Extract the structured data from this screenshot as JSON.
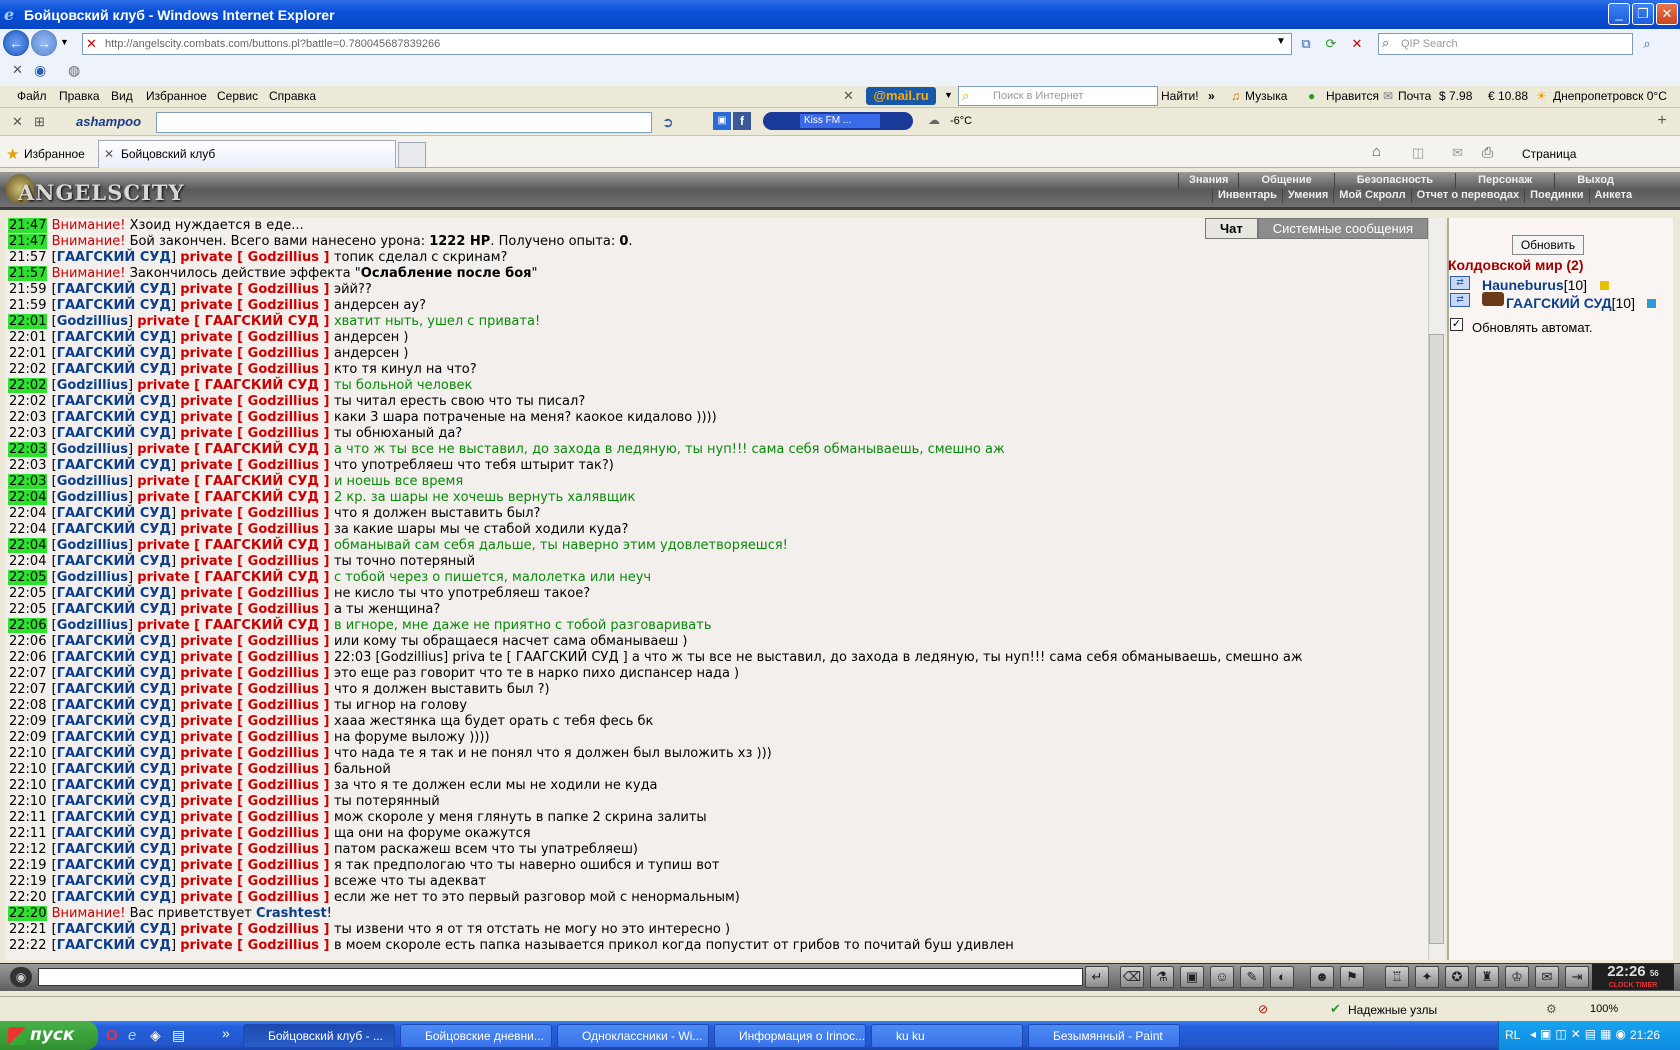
{
  "window": {
    "title": "Бойцовский клуб - Windows Internet Explorer"
  },
  "address": {
    "url": "http://angelscity.combats.com/buttons.pl?battle=0.780045687839266",
    "search_placeholder": "QIP Search"
  },
  "menu": [
    "Файл",
    "Правка",
    "Вид",
    "Избранное",
    "Сервис",
    "Справка"
  ],
  "toolbar_mailru": {
    "logo": "@mail.ru",
    "search_placeholder": "Поиск в Интернет",
    "find": "Найти!",
    "music": "Музыка",
    "like": "Нравится",
    "mail": "Почта",
    "usd": "$ 7.98",
    "eur": "€ 10.88",
    "weather": "Днепропетровск 0°C"
  },
  "toolbar2": {
    "brand": "ashampoo",
    "radio": "Kiss FM ...",
    "temp": "-6°C"
  },
  "favorites": {
    "label": "Избранное",
    "tab": "Бойцовский клуб",
    "page_menu": "Страница"
  },
  "game": {
    "logo": "ANGELSCITY",
    "nav_top": [
      "Знания",
      "Общение",
      "Безопасность",
      "Персонаж",
      "Выход"
    ],
    "nav_bottom": [
      "Инвентарь",
      "Умения",
      "Мой Скролл",
      "Отчет о переводах",
      "Поединки",
      "Анкета"
    ]
  },
  "chat_tabs": [
    "Чат",
    "Системные сообщения"
  ],
  "chat": [
    {
      "t": "21:47",
      "hl": true,
      "kind": "warn",
      "text": "Хзоид нуждается в еде..."
    },
    {
      "t": "21:47",
      "hl": true,
      "kind": "warn2",
      "text": "Бой закончен. Всего вами нанесено урона: ",
      "bold1": "1222 HP",
      "mid": ". Получено опыта: ",
      "bold2": "0",
      "tail": "."
    },
    {
      "t": "21:57",
      "kind": "priv",
      "from": "ГААГСКИЙ СУД",
      "to": "Godzillius",
      "text": "топик сделал с скринам?"
    },
    {
      "t": "21:57",
      "hl": true,
      "kind": "warn3",
      "text": "Закончилось действие эффекта \"",
      "bold1": "Ослабление после боя",
      "tail": "\""
    },
    {
      "t": "21:59",
      "kind": "priv",
      "from": "ГААГСКИЙ СУД",
      "to": "Godzillius",
      "text": "эйй??"
    },
    {
      "t": "21:59",
      "kind": "priv",
      "from": "ГААГСКИЙ СУД",
      "to": "Godzillius",
      "text": "андерсен ау?"
    },
    {
      "t": "22:01",
      "hl": true,
      "kind": "privg",
      "from": "Godzillius",
      "to": "ГААГСКИЙ СУД",
      "text": "хватит ныть, ушел с привата!"
    },
    {
      "t": "22:01",
      "kind": "priv",
      "from": "ГААГСКИЙ СУД",
      "to": "Godzillius",
      "text": "андерсен )"
    },
    {
      "t": "22:01",
      "kind": "priv",
      "from": "ГААГСКИЙ СУД",
      "to": "Godzillius",
      "text": "андерсен )"
    },
    {
      "t": "22:02",
      "kind": "priv",
      "from": "ГААГСКИЙ СУД",
      "to": "Godzillius",
      "text": "кто тя кинул на что?"
    },
    {
      "t": "22:02",
      "hl": true,
      "kind": "privg",
      "from": "Godzillius",
      "to": "ГААГСКИЙ СУД",
      "text": "ты больной человек"
    },
    {
      "t": "22:02",
      "kind": "priv",
      "from": "ГААГСКИЙ СУД",
      "to": "Godzillius",
      "text": "ты читал ересть свою что ты писал?"
    },
    {
      "t": "22:03",
      "kind": "priv",
      "from": "ГААГСКИЙ СУД",
      "to": "Godzillius",
      "text": "каки 3 шара потраченые на меня? каокое кидалово ))))"
    },
    {
      "t": "22:03",
      "kind": "priv",
      "from": "ГААГСКИЙ СУД",
      "to": "Godzillius",
      "text": "ты обнюханый да?"
    },
    {
      "t": "22:03",
      "hl": true,
      "kind": "privg",
      "from": "Godzillius",
      "to": "ГААГСКИЙ СУД",
      "text": "а что ж ты все не выставил, до захода в ледяную, ты нуп!!! сама себя обманываешь, смешно аж"
    },
    {
      "t": "22:03",
      "kind": "priv",
      "from": "ГААГСКИЙ СУД",
      "to": "Godzillius",
      "text": "что употребляеш что тебя штырит так?)"
    },
    {
      "t": "22:03",
      "hl": true,
      "kind": "privg",
      "from": "Godzillius",
      "to": "ГААГСКИЙ СУД",
      "text": "и ноешь все время"
    },
    {
      "t": "22:04",
      "hl": true,
      "kind": "privg",
      "from": "Godzillius",
      "to": "ГААГСКИЙ СУД",
      "text": "2 кр. за шары не хочешь вернуть халявщик"
    },
    {
      "t": "22:04",
      "kind": "priv",
      "from": "ГААГСКИЙ СУД",
      "to": "Godzillius",
      "text": "что я должен выставить был?"
    },
    {
      "t": "22:04",
      "kind": "priv",
      "from": "ГААГСКИЙ СУД",
      "to": "Godzillius",
      "text": "за какие шары мы че стабой ходили куда?"
    },
    {
      "t": "22:04",
      "hl": true,
      "kind": "privg",
      "from": "Godzillius",
      "to": "ГААГСКИЙ СУД",
      "text": "обманывай сам себя дальше, ты наверно этим удовлетворяешся!"
    },
    {
      "t": "22:04",
      "kind": "priv",
      "from": "ГААГСКИЙ СУД",
      "to": "Godzillius",
      "text": "ты точно потеряный"
    },
    {
      "t": "22:05",
      "hl": true,
      "kind": "privg",
      "from": "Godzillius",
      "to": "ГААГСКИЙ СУД",
      "text": "с тобой через о пишется, малолетка или неуч"
    },
    {
      "t": "22:05",
      "kind": "priv",
      "from": "ГААГСКИЙ СУД",
      "to": "Godzillius",
      "text": "не кисло ты что употребляеш такое?"
    },
    {
      "t": "22:05",
      "kind": "priv",
      "from": "ГААГСКИЙ СУД",
      "to": "Godzillius",
      "text": "а ты женщина?"
    },
    {
      "t": "22:06",
      "hl": true,
      "kind": "privg",
      "from": "Godzillius",
      "to": "ГААГСКИЙ СУД",
      "text": "в игноре, мне даже не приятно с тобой разговаривать"
    },
    {
      "t": "22:06",
      "kind": "priv",
      "from": "ГААГСКИЙ СУД",
      "to": "Godzillius",
      "text": "или кому ты обращаеся насчет сама обманываеш )"
    },
    {
      "t": "22:06",
      "kind": "priv",
      "from": "ГААГСКИЙ СУД",
      "to": "Godzillius",
      "text": "22:03 [Godzillius] priva te [ ГААГСКИЙ СУД ] а что ж ты все не выставил, до захода в ледяную, ты нуп!!! сама себя обманываешь, смешно аж"
    },
    {
      "t": "22:07",
      "kind": "priv",
      "from": "ГААГСКИЙ СУД",
      "to": "Godzillius",
      "text": "это еще раз говорит что те в нарко пихо диспансер нада )"
    },
    {
      "t": "22:07",
      "kind": "priv",
      "from": "ГААГСКИЙ СУД",
      "to": "Godzillius",
      "text": "что я должен выставить был ?)"
    },
    {
      "t": "22:08",
      "kind": "priv",
      "from": "ГААГСКИЙ СУД",
      "to": "Godzillius",
      "text": "ты игнор на голову"
    },
    {
      "t": "22:09",
      "kind": "priv",
      "from": "ГААГСКИЙ СУД",
      "to": "Godzillius",
      "text": "хааа жестянка ща будет орать с тебя фесь бк"
    },
    {
      "t": "22:09",
      "kind": "priv",
      "from": "ГААГСКИЙ СУД",
      "to": "Godzillius",
      "text": "на форуме выложу ))))"
    },
    {
      "t": "22:10",
      "kind": "priv",
      "from": "ГААГСКИЙ СУД",
      "to": "Godzillius",
      "text": "что нада те я так и не понял что я должен был выложить хз )))"
    },
    {
      "t": "22:10",
      "kind": "priv",
      "from": "ГААГСКИЙ СУД",
      "to": "Godzillius",
      "text": "бальной"
    },
    {
      "t": "22:10",
      "kind": "priv",
      "from": "ГААГСКИЙ СУД",
      "to": "Godzillius",
      "text": "за что я те должен если мы не ходили не куда"
    },
    {
      "t": "22:10",
      "kind": "priv",
      "from": "ГААГСКИЙ СУД",
      "to": "Godzillius",
      "text": "ты потерянный"
    },
    {
      "t": "22:11",
      "kind": "priv",
      "from": "ГААГСКИЙ СУД",
      "to": "Godzillius",
      "text": "мож скороле у меня глянуть в папке 2 скрина залиты"
    },
    {
      "t": "22:11",
      "kind": "priv",
      "from": "ГААГСКИЙ СУД",
      "to": "Godzillius",
      "text": "ща они на форуме окажутся"
    },
    {
      "t": "22:12",
      "kind": "priv",
      "from": "ГААГСКИЙ СУД",
      "to": "Godzillius",
      "text": "патом раскажеш всем что ты упатребляеш)"
    },
    {
      "t": "22:19",
      "kind": "priv",
      "from": "ГААГСКИЙ СУД",
      "to": "Godzillius",
      "text": "я так предпологаю что ты наверно ошибся и тупиш вот"
    },
    {
      "t": "22:19",
      "kind": "priv",
      "from": "ГААГСКИЙ СУД",
      "to": "Godzillius",
      "text": "всеже что ты адекват"
    },
    {
      "t": "22:20",
      "kind": "priv",
      "from": "ГААГСКИЙ СУД",
      "to": "Godzillius",
      "text": "если же нет то это первый разговор мой с ненормальным)"
    },
    {
      "t": "22:20",
      "hl": true,
      "kind": "warn4",
      "text": "Вас приветствует ",
      "bold1": "Crashtest",
      "tail": "!"
    },
    {
      "t": "22:21",
      "kind": "priv",
      "from": "ГААГСКИЙ СУД",
      "to": "Godzillius",
      "text": "ты извени что я от тя отстать не могу но это интересно )"
    },
    {
      "t": "22:22",
      "kind": "priv",
      "from": "ГААГСКИЙ СУД",
      "to": "Godzillius",
      "text": "в моем скороле есть папка называется прикол когда попустит от грибов то почитай буш удивлен"
    }
  ],
  "strings": {
    "warn": "Внимание!",
    "private": "private"
  },
  "right_panel": {
    "refresh": "Обновить",
    "room": "Колдовской мир (2)",
    "users": [
      {
        "name": "Hauneburus",
        "level": "[10]"
      },
      {
        "name": "ГААГСКИЙ СУД",
        "level": "[10]"
      }
    ],
    "auto_refresh_label": "Обновлять автомат.",
    "auto_refresh_checked": true
  },
  "clock": {
    "time": "22:26",
    "sec": "56",
    "label": "CLOCK TIMER"
  },
  "status": {
    "zone": "Надежные узлы",
    "zoom": "100%"
  },
  "taskbar": {
    "start": "пуск",
    "items": [
      "Бойцовский клуб - ...",
      "Бойцовские дневни...",
      "Одноклассники - Wi...",
      "Информация о Irinoc...",
      "ku ku",
      "Безымянный - Paint"
    ],
    "lang": "RL",
    "time": "21:26"
  }
}
